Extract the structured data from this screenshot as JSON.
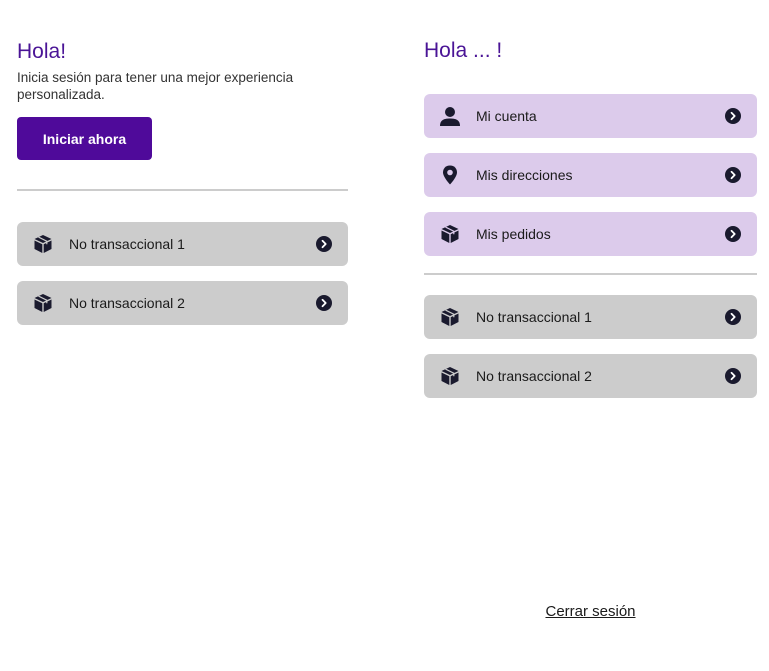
{
  "guest": {
    "greeting": "Hola!",
    "subtitle": "Inicia sesión para tener una mejor experiencia personalizada.",
    "login_button": "Iniciar ahora",
    "items": [
      {
        "label": "No transaccional 1",
        "icon": "box-icon"
      },
      {
        "label": "No transaccional 2",
        "icon": "box-icon"
      }
    ]
  },
  "user": {
    "greeting": "Hola ... !",
    "account_items": [
      {
        "label": "Mi cuenta",
        "icon": "user-icon"
      },
      {
        "label": "Mis direcciones",
        "icon": "location-pin-icon"
      },
      {
        "label": "Mis pedidos",
        "icon": "box-icon"
      }
    ],
    "items": [
      {
        "label": "No transaccional 1",
        "icon": "box-icon"
      },
      {
        "label": "No transaccional 2",
        "icon": "box-icon"
      }
    ],
    "logout": "Cerrar sesión"
  },
  "colors": {
    "accent": "#4f0a9a",
    "title": "#4a1496",
    "account_item_bg": "#dccbeb",
    "item_bg": "#cccccc"
  }
}
